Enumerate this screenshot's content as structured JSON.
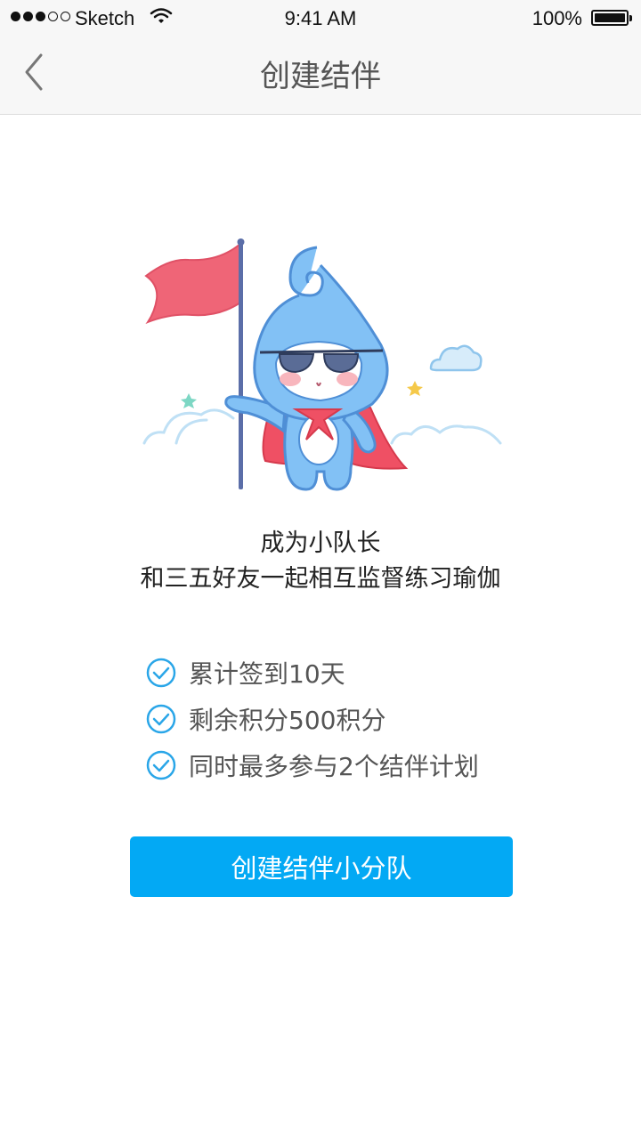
{
  "status_bar": {
    "carrier": "Sketch",
    "time": "9:41 AM",
    "battery": "100%"
  },
  "nav": {
    "title": "创建结伴"
  },
  "intro": {
    "line1": "成为小队长",
    "line2": "和三五好友一起相互监督练习瑜伽"
  },
  "benefits": [
    {
      "label": "累计签到10天"
    },
    {
      "label": "剩余积分500积分"
    },
    {
      "label": "同时最多参与2个结伴计划"
    }
  ],
  "cta": {
    "label": "创建结伴小分队"
  },
  "colors": {
    "accent": "#03a9f4",
    "check": "#2aa6e8",
    "flag": "#ef6577",
    "mascot": "#82c1f5"
  }
}
